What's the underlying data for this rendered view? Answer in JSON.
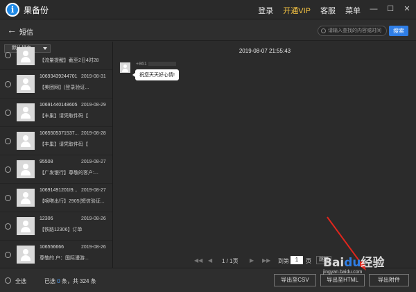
{
  "app": {
    "logo": "i",
    "title": "果备份",
    "menu": {
      "login": "登录",
      "vip": "开通VIP",
      "support": "客服",
      "menu": "菜单"
    },
    "window_controls": [
      "minimize-icon",
      "maximize-icon",
      "close-icon"
    ]
  },
  "subheader": {
    "title": "短信",
    "search_placeholder": "请输入查找的内容或时间",
    "search_button": "搜索"
  },
  "sort": {
    "selected": "默认排序"
  },
  "messages": [
    {
      "sender": "",
      "date": "",
      "preview": "【流量提醒】截至2日4时28"
    },
    {
      "sender": "10693439244701",
      "date": "2019-08-31",
      "preview": "【美团网】(登录验证..."
    },
    {
      "sender": "10691440148605",
      "date": "2019-08-29",
      "preview": "【丰巢】请凭取件码【"
    },
    {
      "sender": "1065505371537...",
      "date": "2019-08-28",
      "preview": "【丰巢】请凭取件码【"
    },
    {
      "sender": "95508",
      "date": "2019-08-27",
      "preview": "【广发银行】尊敬的客户:..."
    },
    {
      "sender": "10691491201I9...",
      "date": "2019-08-27",
      "preview": "【嘀嗒出行】2905(短信验证..."
    },
    {
      "sender": "12306",
      "date": "2019-08-26",
      "preview": "【铁路12306】订单"
    },
    {
      "sender": "106556666",
      "date": "2019-08-26",
      "preview": "尊敬的      户：国际漫游..."
    }
  ],
  "conversation": {
    "timestamp": "2019-08-07 21:55:43",
    "sender_prefix": "+861",
    "message": "祝您天天好心情!"
  },
  "pager": {
    "page_info": "1 / 1页",
    "goto_label": "到第",
    "page_value": "1",
    "page_unit": "页",
    "goto_button": "跳转"
  },
  "bottom": {
    "select_all": "全选",
    "selected_prefix": "已选",
    "selected_count": "0",
    "selected_mid": "条，共",
    "total": "324",
    "selected_suffix": "条",
    "buttons": {
      "export_csv": "导出至CSV",
      "export_html": "导出至HTML",
      "export_doc": "导出附件"
    }
  },
  "watermark": {
    "logo": "Bai",
    "logo_paw": "du",
    "logo_suffix": "经验",
    "url": "jingyan.baidu.com"
  },
  "colors": {
    "accent": "#2f7ee6",
    "vip": "#f6c443",
    "background": "#2b2b2b"
  }
}
